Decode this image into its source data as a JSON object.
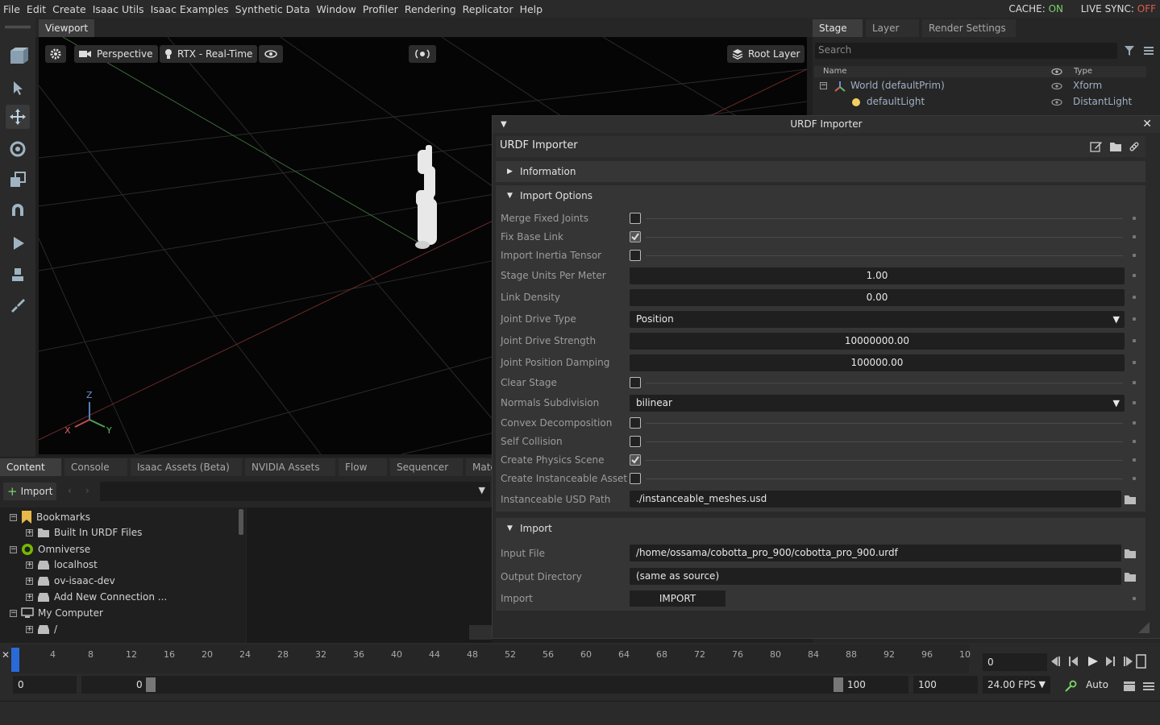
{
  "menu": [
    "File",
    "Edit",
    "Create",
    "Isaac Utils",
    "Isaac Examples",
    "Synthetic Data",
    "Window",
    "Profiler",
    "Rendering",
    "Replicator",
    "Help"
  ],
  "cache": {
    "label": "CACHE:",
    "value": "ON",
    "color": "#7bd36b"
  },
  "live_sync": {
    "label": "LIVE SYNC:",
    "value": "OFF",
    "color": "#e05c4a"
  },
  "viewport": {
    "tab": "Viewport",
    "camera": "Perspective",
    "renderer": "RTX - Real-Time",
    "layer": "Root Layer",
    "axes": {
      "z": "Z",
      "x": "X",
      "y": "Y"
    }
  },
  "stage": {
    "tabs": [
      "Stage",
      "Layer",
      "Render Settings"
    ],
    "search_placeholder": "Search",
    "col_name": "Name",
    "col_type": "Type",
    "rows": [
      {
        "name": "World (defaultPrim)",
        "type": "Xform"
      },
      {
        "name": "defaultLight",
        "type": "DistantLight"
      }
    ]
  },
  "urdf": {
    "window_title": "URDF Importer",
    "panel_title": "URDF Importer",
    "sections": {
      "information": "Information",
      "import_options": "Import Options",
      "import": "Import"
    },
    "options": {
      "merge_fixed_joints": {
        "label": "Merge Fixed Joints",
        "checked": false
      },
      "fix_base_link": {
        "label": "Fix Base Link",
        "checked": true
      },
      "import_inertia_tensor": {
        "label": "Import Inertia Tensor",
        "checked": false
      },
      "stage_units": {
        "label": "Stage Units Per Meter",
        "value": "1.00"
      },
      "link_density": {
        "label": "Link Density",
        "value": "0.00"
      },
      "joint_drive_type": {
        "label": "Joint Drive Type",
        "value": "Position"
      },
      "joint_drive_strength": {
        "label": "Joint Drive Strength",
        "value": "10000000.00"
      },
      "joint_position_damping": {
        "label": "Joint Position Damping",
        "value": "100000.00"
      },
      "clear_stage": {
        "label": "Clear Stage",
        "checked": false
      },
      "normals_subdivision": {
        "label": "Normals Subdivision",
        "value": "bilinear"
      },
      "convex_decomposition": {
        "label": "Convex Decomposition",
        "checked": false
      },
      "self_collision": {
        "label": "Self Collision",
        "checked": false
      },
      "create_physics_scene": {
        "label": "Create Physics Scene",
        "checked": true
      },
      "create_instanceable_asset": {
        "label": "Create Instanceable Asset",
        "checked": false
      },
      "instanceable_usd_path": {
        "label": "Instanceable USD Path",
        "value": "./instanceable_meshes.usd"
      }
    },
    "import": {
      "input_file_label": "Input File",
      "input_file": "/home/ossama/cobotta_pro_900/cobotta_pro_900.urdf",
      "output_dir_label": "Output Directory",
      "output_dir": "(same as source)",
      "import_label": "Import",
      "import_button": "IMPORT"
    }
  },
  "content": {
    "tabs": [
      "Content",
      "Console",
      "Isaac Assets (Beta)",
      "NVIDIA Assets",
      "Flow",
      "Sequencer",
      "Mate"
    ],
    "import_button": "Import",
    "tree": [
      {
        "label": "Bookmarks"
      },
      {
        "label": "Built In URDF Files"
      },
      {
        "label": "Omniverse"
      },
      {
        "label": "localhost"
      },
      {
        "label": "ov-isaac-dev"
      },
      {
        "label": "Add New Connection ..."
      },
      {
        "label": "My Computer"
      },
      {
        "label": "/"
      }
    ]
  },
  "timeline": {
    "ticks": [
      "4",
      "8",
      "12",
      "16",
      "20",
      "24",
      "28",
      "32",
      "36",
      "40",
      "44",
      "48",
      "52",
      "56",
      "60",
      "64",
      "68",
      "72",
      "76",
      "80",
      "84",
      "88",
      "92",
      "96",
      "10"
    ],
    "current_frame": "0",
    "start": "0",
    "range_start": "0",
    "range_end": "100",
    "end": "100",
    "fps": "24.00 FPS",
    "auto": "Auto"
  }
}
